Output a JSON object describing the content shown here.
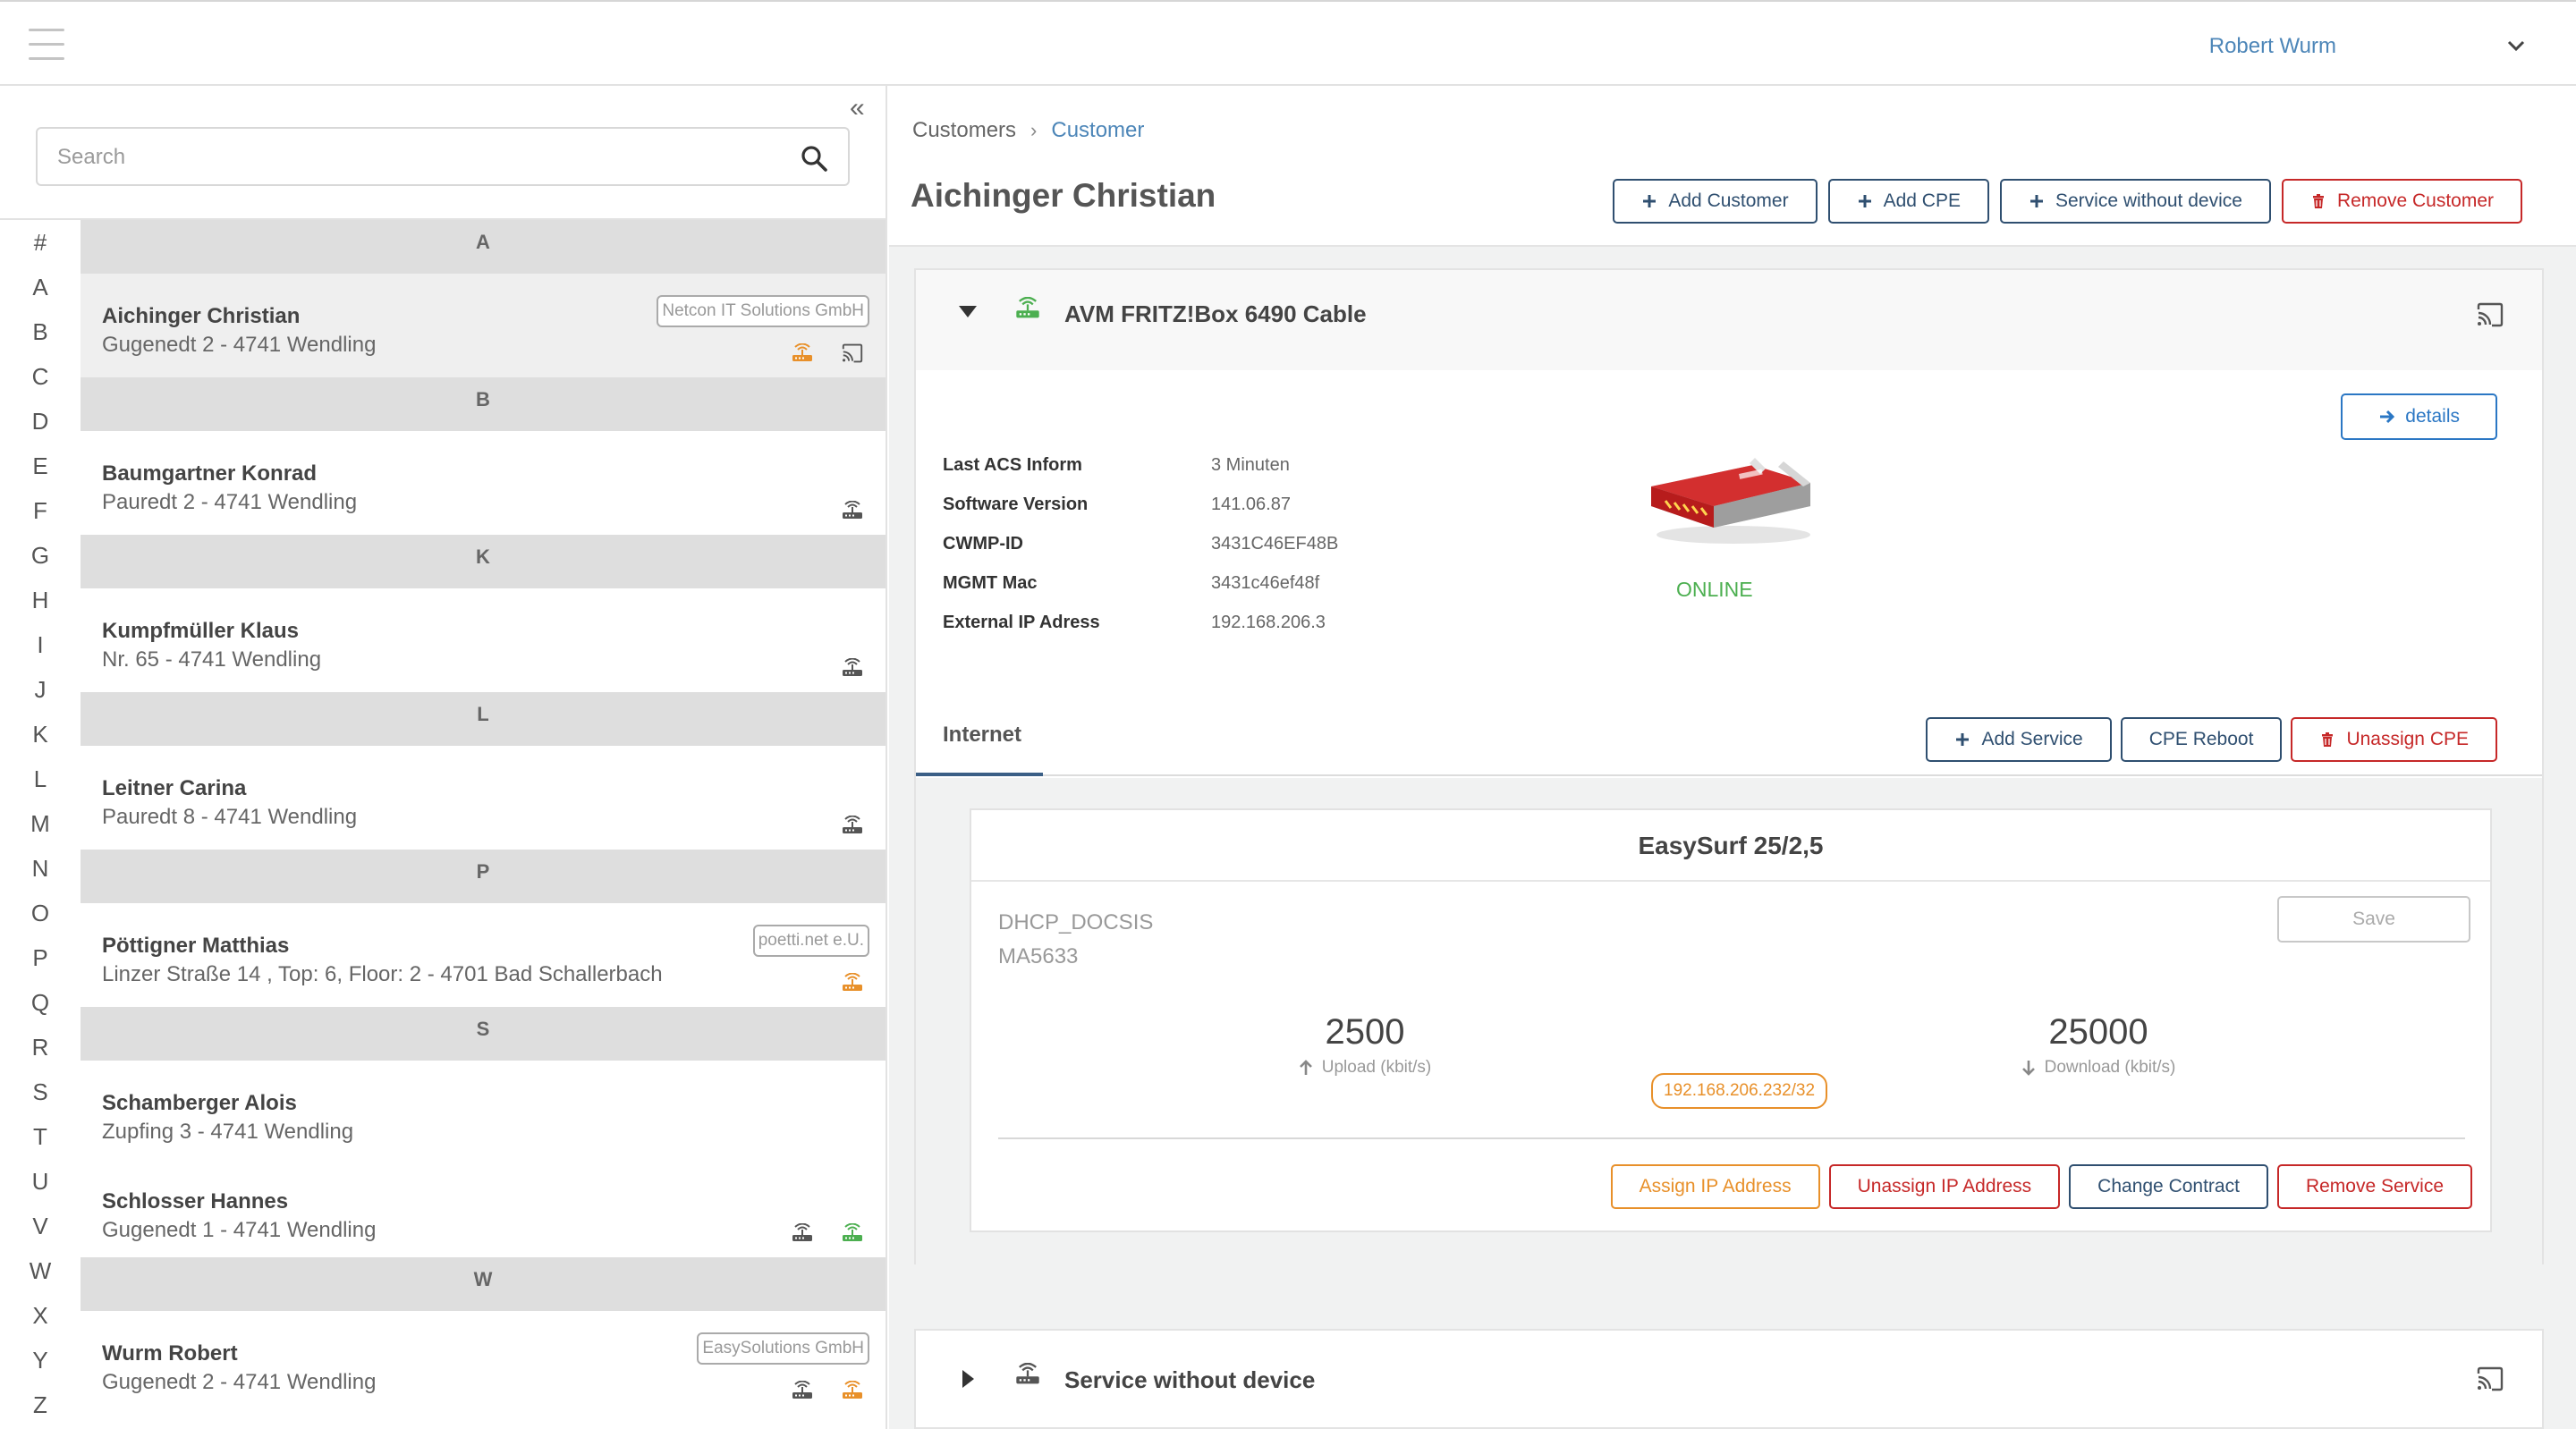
{
  "topbar": {
    "user_name": "Robert Wurm"
  },
  "search": {
    "placeholder": "Search"
  },
  "alphabet": [
    "#",
    "A",
    "B",
    "C",
    "D",
    "E",
    "F",
    "G",
    "H",
    "I",
    "J",
    "K",
    "L",
    "M",
    "N",
    "O",
    "P",
    "Q",
    "R",
    "S",
    "T",
    "U",
    "V",
    "W",
    "X",
    "Y",
    "Z"
  ],
  "customer_list": {
    "headers": {
      "a": "A",
      "b": "B",
      "k": "K",
      "l": "L",
      "p": "P",
      "s": "S",
      "w": "W"
    },
    "customers": [
      {
        "name": "Aichinger Christian",
        "address": "Gugenedt 2 - 4741 Wendling",
        "tag": "Netcon IT Solutions GmbH"
      },
      {
        "name": "Baumgartner Konrad",
        "address": "Pauredt 2 - 4741 Wendling"
      },
      {
        "name": "Kumpfmüller Klaus",
        "address": "Nr. 65 - 4741 Wendling"
      },
      {
        "name": "Leitner Carina",
        "address": "Pauredt 8 - 4741 Wendling"
      },
      {
        "name": "Pöttigner Matthias",
        "address": "Linzer Straße 14 , Top: 6, Floor: 2 - 4701 Bad Schallerbach",
        "tag": "poetti.net e.U."
      },
      {
        "name": "Schamberger Alois",
        "address": "Zupfing 3 - 4741 Wendling"
      },
      {
        "name": "Schlosser Hannes",
        "address": "Gugenedt 1 - 4741 Wendling"
      },
      {
        "name": "Wurm Robert",
        "address": "Gugenedt 2 - 4741 Wendling",
        "tag": "EasySolutions GmbH"
      }
    ]
  },
  "breadcrumb": {
    "root": "Customers",
    "current": "Customer"
  },
  "page_title": "Aichinger Christian",
  "header_buttons": {
    "add_customer": "Add Customer",
    "add_cpe": "Add CPE",
    "service_without_device": "Service without device",
    "remove_customer": "Remove Customer"
  },
  "device": {
    "name": "AVM FRITZ!Box 6490 Cable",
    "details_label": "details",
    "info": [
      {
        "key": "Last ACS Inform",
        "value": "3 Minuten"
      },
      {
        "key": "Software Version",
        "value": "141.06.87"
      },
      {
        "key": "CWMP-ID",
        "value": "3431C46EF48B"
      },
      {
        "key": "MGMT Mac",
        "value": "3431c46ef48f"
      },
      {
        "key": "External IP Adress",
        "value": "192.168.206.3"
      }
    ],
    "status": "ONLINE",
    "status_color": "#4caf50"
  },
  "tabs": {
    "internet": "Internet"
  },
  "tab_buttons": {
    "add_service": "Add Service",
    "cpe_reboot": "CPE Reboot",
    "unassign_cpe": "Unassign CPE"
  },
  "service": {
    "title": "EasySurf 25/2,5",
    "protocol": "DHCP_DOCSIS",
    "model": "MA5633",
    "save_label": "Save",
    "upload_value": "2500",
    "upload_label": "Upload (kbit/s)",
    "download_value": "25000",
    "download_label": "Download (kbit/s)",
    "ip": "192.168.206.232/32",
    "buttons": {
      "assign_ip": "Assign IP Address",
      "unassign_ip": "Unassign IP Address",
      "change_contract": "Change Contract",
      "remove_service": "Remove Service"
    }
  },
  "service_without_device": {
    "label": "Service without device"
  },
  "colors": {
    "accent_blue": "#4d86b8",
    "navy": "#2f4f70",
    "danger": "#c62828",
    "warning": "#e8902a",
    "online": "#4caf50"
  }
}
